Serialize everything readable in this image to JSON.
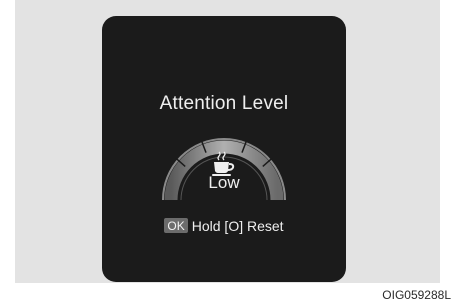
{
  "display": {
    "title": "Attention Level",
    "level_label": "Low",
    "level_icon": "coffee-cup-icon",
    "hint": {
      "ok_key": "OK",
      "text": "Hold [O] Reset"
    }
  },
  "figure_code": "OIG059288L",
  "colors": {
    "panel": "#e3e3e3",
    "screen": "#1b1b1b",
    "gauge_arc": "#9a9a9a",
    "text": "#efefef"
  }
}
